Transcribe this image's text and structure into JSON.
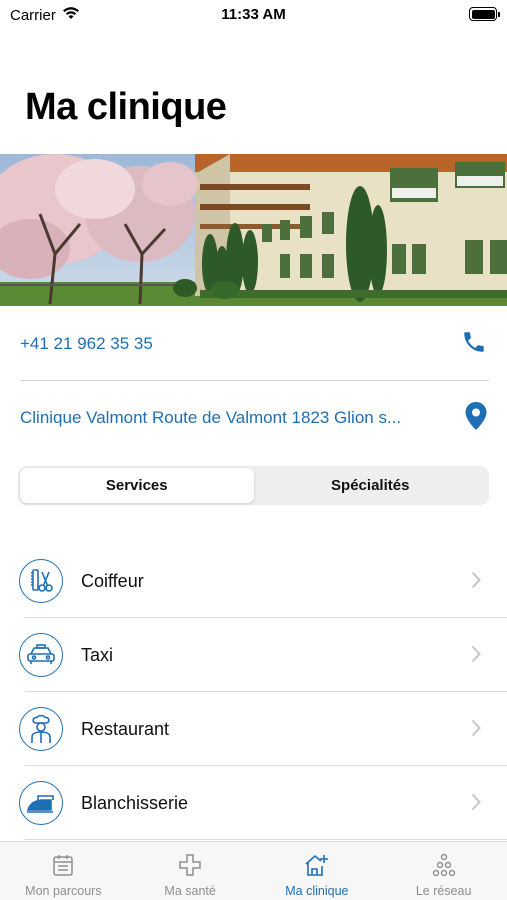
{
  "status_bar": {
    "carrier": "Carrier",
    "time": "11:33 AM"
  },
  "page": {
    "title": "Ma clinique"
  },
  "contact": {
    "phone": "+41 21 962 35 35",
    "address": "Clinique Valmont Route de Valmont 1823 Glion s..."
  },
  "segments": [
    {
      "label": "Services",
      "selected": true
    },
    {
      "label": "Spécialités",
      "selected": false
    }
  ],
  "services": [
    {
      "label": "Coiffeur",
      "icon": "scissors-comb-icon"
    },
    {
      "label": "Taxi",
      "icon": "taxi-icon"
    },
    {
      "label": "Restaurant",
      "icon": "chef-icon"
    },
    {
      "label": "Blanchisserie",
      "icon": "iron-icon"
    }
  ],
  "tabs": [
    {
      "label": "Mon parcours",
      "icon": "calendar-icon",
      "active": false
    },
    {
      "label": "Ma santé",
      "icon": "health-cross-icon",
      "active": false
    },
    {
      "label": "Ma clinique",
      "icon": "clinic-icon",
      "active": true
    },
    {
      "label": "Le réseau",
      "icon": "network-icon",
      "active": false
    }
  ],
  "colors": {
    "accent": "#1e6fb5",
    "inactive": "#8e8e93"
  }
}
